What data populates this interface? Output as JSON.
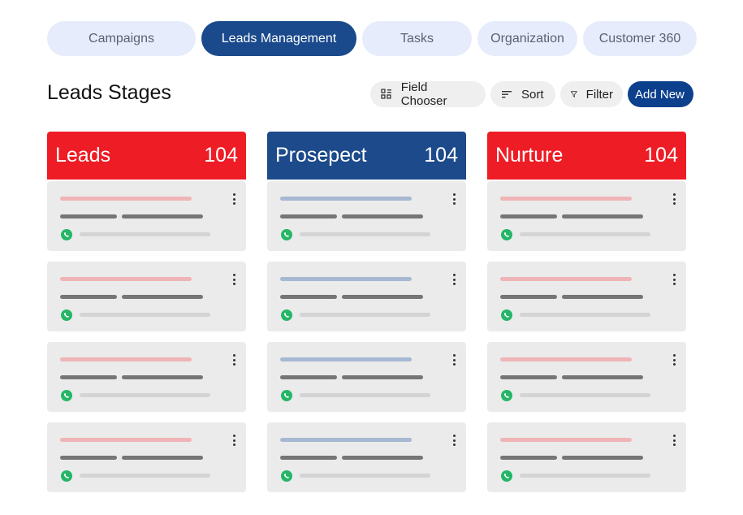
{
  "tabs": [
    {
      "label": "Campaigns",
      "active": false
    },
    {
      "label": "Leads Management",
      "active": true
    },
    {
      "label": "Tasks",
      "active": false
    },
    {
      "label": "Organization",
      "active": false
    },
    {
      "label": "Customer 360",
      "active": false
    }
  ],
  "page_title": "Leads Stages",
  "toolbar": {
    "field_chooser": "Field Chooser",
    "sort": "Sort",
    "filter": "Filter",
    "add_new": "Add New"
  },
  "columns": [
    {
      "title": "Leads",
      "count": "104",
      "color": "#ee1c25",
      "accent_bar": "#f0b4b6"
    },
    {
      "title": "Prosepect",
      "count": "104",
      "color": "#1c4a8a",
      "accent_bar": "#a6b8d2"
    },
    {
      "title": "Nurture",
      "count": "104",
      "color": "#ee1c25",
      "accent_bar": "#f0b4b6"
    }
  ],
  "colors": {
    "tab_bg": "#e6ecfb",
    "tab_active": "#1a4a8c",
    "card_bg": "#ebebeb",
    "placeholder_dark": "#767676",
    "placeholder_light": "#d4d4d4",
    "whatsapp": "#25b667"
  },
  "icons": {
    "field_chooser": "grid-icon",
    "sort": "sort-lines-icon",
    "filter": "funnel-icon",
    "card_menu": "kebab-menu-icon",
    "card_channel": "whatsapp-icon"
  }
}
